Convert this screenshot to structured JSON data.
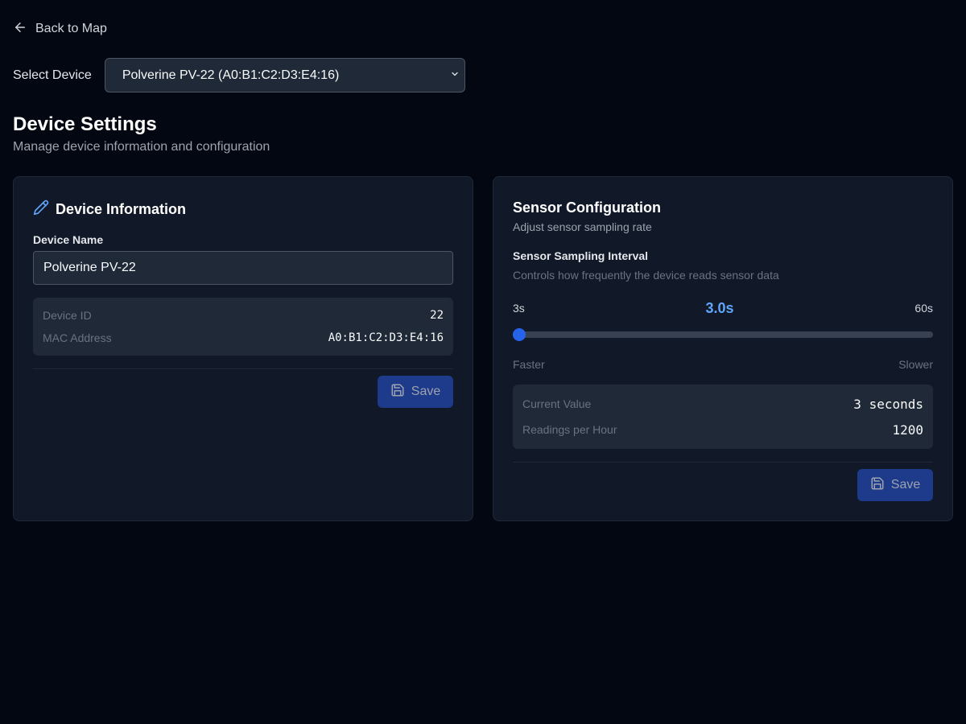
{
  "nav": {
    "back_label": "Back to Map"
  },
  "device_select": {
    "label": "Select Device",
    "selected": "Polverine PV-22 (A0:B1:C2:D3:E4:16)"
  },
  "page": {
    "title": "Device Settings",
    "subtitle": "Manage device information and configuration"
  },
  "device_info": {
    "title": "Device Information",
    "name_label": "Device Name",
    "name_value": "Polverine PV-22",
    "rows": [
      {
        "key": "Device ID",
        "value": "22"
      },
      {
        "key": "MAC Address",
        "value": "A0:B1:C2:D3:E4:16"
      }
    ],
    "save_label": "Save"
  },
  "sensor_config": {
    "title": "Sensor Configuration",
    "subtitle": "Adjust sensor sampling rate",
    "interval_label": "Sensor Sampling Interval",
    "interval_desc": "Controls how frequently the device reads sensor data",
    "range_min_label": "3s",
    "range_max_label": "60s",
    "current_label": "3.0s",
    "slider": {
      "min": 3,
      "max": 60,
      "value": 3
    },
    "faster_label": "Faster",
    "slower_label": "Slower",
    "rows": [
      {
        "key": "Current Value",
        "value": "3 seconds"
      },
      {
        "key": "Readings per Hour",
        "value": "1200"
      }
    ],
    "save_label": "Save"
  },
  "colors": {
    "background": "#030712",
    "card": "#111827",
    "accent": "#60a5fa",
    "button": "#1e3a8a"
  }
}
